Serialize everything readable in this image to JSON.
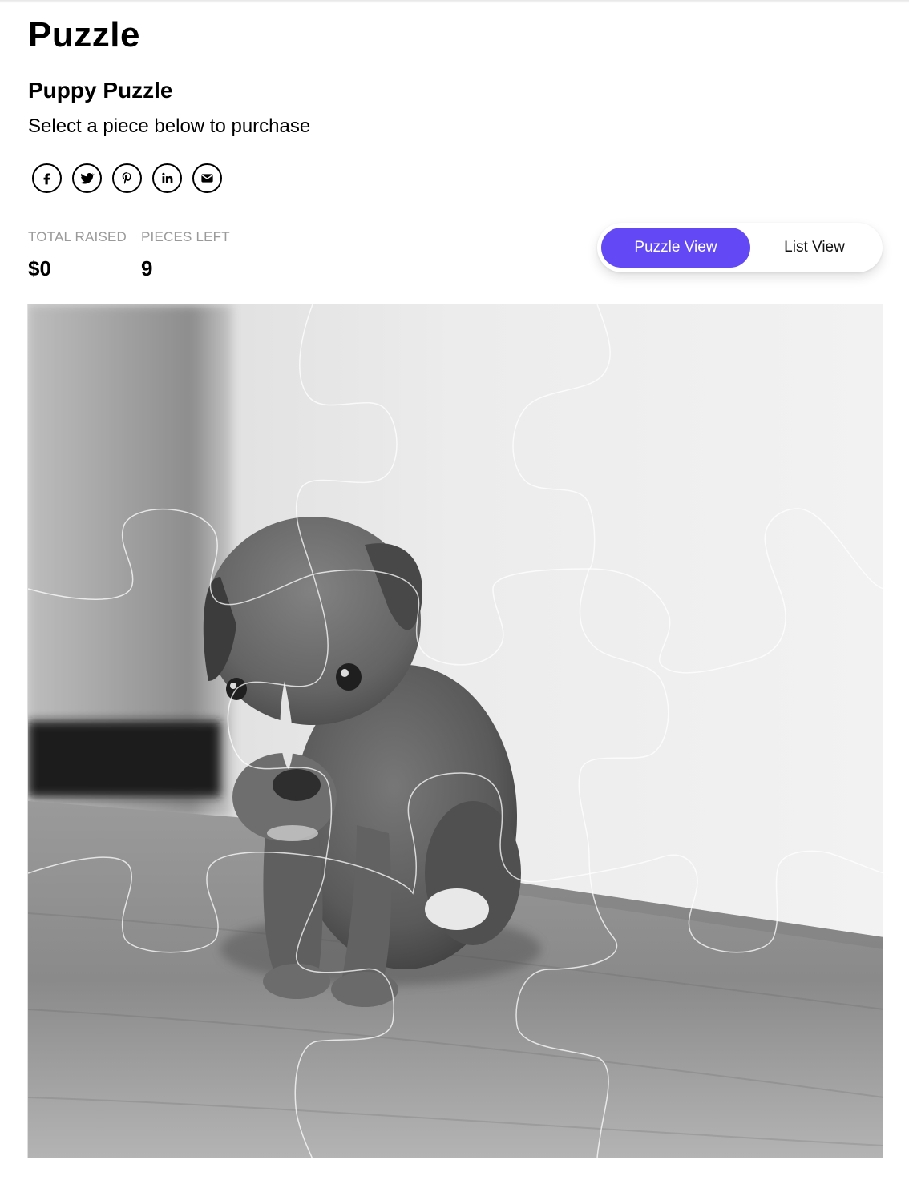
{
  "page": {
    "title": "Puzzle"
  },
  "puzzle": {
    "name": "Puppy Puzzle",
    "instruction": "Select a piece below to purchase",
    "image_alt": "Black and white photo of a puppy sitting on a wooden floor"
  },
  "share": {
    "buttons": [
      {
        "icon": "facebook-icon"
      },
      {
        "icon": "twitter-icon"
      },
      {
        "icon": "pinterest-icon"
      },
      {
        "icon": "linkedin-icon"
      },
      {
        "icon": "email-icon"
      }
    ]
  },
  "stats": {
    "total_raised": {
      "label": "TOTAL RAISED",
      "value": "$0"
    },
    "pieces_left": {
      "label": "PIECES LEFT",
      "value": "9"
    }
  },
  "view_toggle": {
    "options": [
      "Puzzle View",
      "List View"
    ],
    "selected": "Puzzle View"
  },
  "colors": {
    "accent": "#6348f5",
    "muted_label": "#9a9a9a",
    "piece_outline": "#ffffff"
  }
}
